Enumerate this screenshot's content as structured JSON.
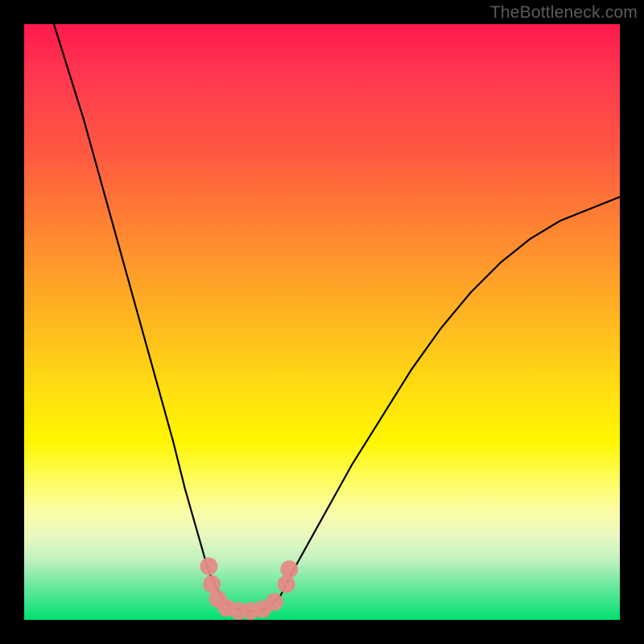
{
  "watermark": "TheBottleneck.com",
  "chart_data": {
    "type": "line",
    "title": "",
    "xlabel": "",
    "ylabel": "",
    "xlim": [
      0,
      100
    ],
    "ylim": [
      0,
      100
    ],
    "grid": false,
    "series": [
      {
        "name": "bottleneck-curve",
        "x": [
          5,
          10,
          15,
          20,
          25,
          27,
          29,
          31,
          33,
          35,
          37,
          39,
          41,
          43,
          45,
          50,
          55,
          60,
          65,
          70,
          75,
          80,
          85,
          90,
          95,
          100
        ],
        "y": [
          100,
          84,
          66,
          48,
          30,
          22,
          15,
          8,
          4,
          2,
          1.5,
          1.5,
          2,
          4,
          8,
          17,
          26,
          34,
          42,
          49,
          55,
          60,
          64,
          67,
          69,
          71
        ],
        "color": "#000000"
      }
    ],
    "markers": {
      "name": "bottleneck-markers",
      "color": "#e58b85",
      "points": [
        {
          "x": 31.0,
          "y": 9.0
        },
        {
          "x": 31.5,
          "y": 6.0
        },
        {
          "x": 32.5,
          "y": 3.5
        },
        {
          "x": 34.0,
          "y": 2.0
        },
        {
          "x": 36.0,
          "y": 1.5
        },
        {
          "x": 38.0,
          "y": 1.5
        },
        {
          "x": 40.0,
          "y": 1.8
        },
        {
          "x": 42.0,
          "y": 3.0
        },
        {
          "x": 44.0,
          "y": 6.0
        },
        {
          "x": 44.5,
          "y": 8.5
        }
      ]
    }
  }
}
